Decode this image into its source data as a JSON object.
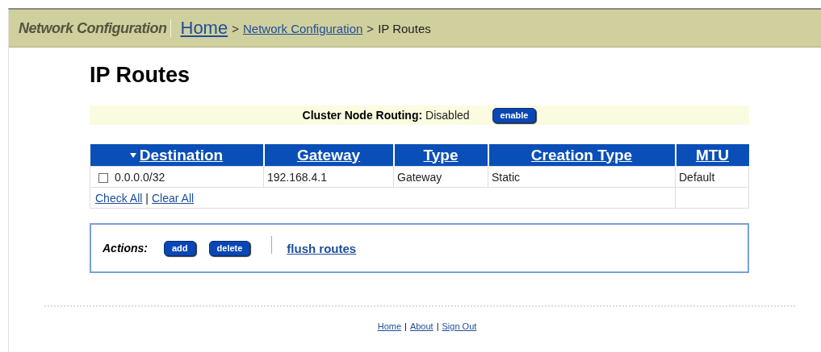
{
  "header": {
    "section_title": "Network Configuration",
    "breadcrumb_separator": ">",
    "breadcrumb": [
      {
        "label": "Home",
        "link": true,
        "large": true
      },
      {
        "label": "Network Configuration",
        "link": true,
        "large": false
      },
      {
        "label": "IP Routes",
        "link": false,
        "large": false
      }
    ]
  },
  "page_title": "IP Routes",
  "cluster_routing": {
    "label": "Cluster Node Routing:",
    "value": "Disabled",
    "button": "enable"
  },
  "table": {
    "columns": [
      {
        "label": "Destination",
        "sorted": true
      },
      {
        "label": "Gateway",
        "sorted": false
      },
      {
        "label": "Type",
        "sorted": false
      },
      {
        "label": "Creation Type",
        "sorted": false
      },
      {
        "label": "MTU",
        "sorted": false
      }
    ],
    "rows": [
      {
        "checked": false,
        "cells": [
          "0.0.0.0/32",
          "192.168.4.1",
          "Gateway",
          "Static",
          "Default"
        ]
      }
    ],
    "footer_links": [
      "Check All",
      "Clear All"
    ],
    "footer_separator": "|"
  },
  "actions": {
    "label": "Actions:",
    "buttons": [
      "add",
      "delete"
    ],
    "link": "flush routes"
  },
  "footer_links": [
    "Home",
    "About",
    "Sign Out"
  ],
  "footer_separator": "|"
}
